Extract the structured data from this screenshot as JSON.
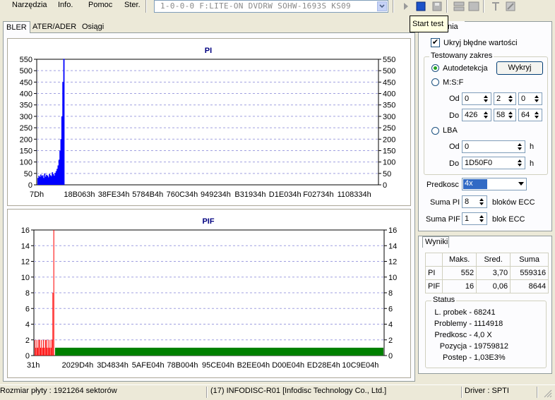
{
  "menu": {
    "narzedzia": "Narzędzia",
    "info": "Info.",
    "pomoc": "Pomoc",
    "ster": "Ster."
  },
  "drive": {
    "value": "1-0-0-0 F:LITE-ON DVDRW SOHW-1693S KS09"
  },
  "toolbar": {
    "tooltip": "Start test"
  },
  "tabs": {
    "bler": "BLER",
    "ater": "ATER/ADER",
    "osiagi": "Osiągi"
  },
  "settings": {
    "tab_fragment": "nia",
    "hide_errors": "Ukryj błędne wartości",
    "range_group": "Testowany zakres",
    "autodetect": "Autodetekcja",
    "detect_button": "Wykryj",
    "msf": "M:S:F",
    "od": "Od",
    "do": "Do",
    "msf_from": [
      "0",
      "2",
      "0"
    ],
    "msf_to": [
      "426",
      "58",
      "64"
    ],
    "lba": "LBA",
    "lba_from": "0",
    "lba_to": "1D50F0",
    "h": "h",
    "speed_label": "Predkosc",
    "speed_value": "4x",
    "sum_pi_label": "Suma PI",
    "sum_pi_value": "8",
    "sum_pi_unit": "bloków ECC",
    "sum_pif_label": "Suma PIF",
    "sum_pif_value": "1",
    "sum_pif_unit": "blok ECC"
  },
  "results": {
    "tab": "Wyniki",
    "headers": [
      "",
      "Maks.",
      "Sred.",
      "Suma"
    ],
    "rows": [
      [
        "PI",
        "552",
        "3,70",
        "559316"
      ],
      [
        "PIF",
        "16",
        "0,06",
        "8644"
      ]
    ],
    "status_group": "Status",
    "status": [
      {
        "label": "L. probek -",
        "value": "68241"
      },
      {
        "label": "Problemy -",
        "value": "1114918"
      },
      {
        "label": "Predkosc -",
        "value": "4,0  X"
      },
      {
        "label": "Pozycja -",
        "value": "19759812"
      },
      {
        "label": "Postep -",
        "value": "1,03E3%"
      }
    ]
  },
  "statusbar": {
    "size": "Rozmiar płyty : 1921264 sektorów",
    "disc": "(17) INFODISC-R01 [Infodisc Technology Co., Ltd.]",
    "driver": "Driver : SPTI"
  },
  "chart_data": [
    {
      "type": "bar",
      "title": "PI",
      "ylim": [
        0,
        550
      ],
      "yticks": [
        0,
        50,
        100,
        150,
        200,
        250,
        300,
        350,
        400,
        450,
        500,
        550
      ],
      "xticks": [
        "7Dh",
        "18B063h",
        "38FE34h",
        "5784B4h",
        "760C34h",
        "949234h",
        "B31934h",
        "D1E034h",
        "F02734h",
        "1108334h"
      ],
      "series": [
        {
          "color": "#0000ff",
          "values": [
            30,
            40,
            35,
            45,
            38,
            42,
            30,
            50,
            36,
            44,
            40,
            33,
            48,
            42,
            38,
            55,
            47,
            40,
            52,
            60,
            70,
            85,
            110,
            150,
            200,
            300,
            450,
            552
          ]
        }
      ],
      "grid": true
    },
    {
      "type": "bar",
      "title": "PIF",
      "ylim": [
        0,
        16
      ],
      "yticks": [
        0,
        2,
        4,
        6,
        8,
        10,
        12,
        14,
        16
      ],
      "xticks": [
        "31h",
        "2029D4h",
        "3D4834h",
        "5AFE04h",
        "78B004h",
        "95CE04h",
        "B2EE04h",
        "D00E04h",
        "ED28E4h",
        "10C9E04h"
      ],
      "series": [
        {
          "color": "#ff0000",
          "values": [
            2,
            1,
            2,
            1,
            2,
            2,
            1,
            2,
            1,
            2,
            1,
            2,
            2,
            1,
            2,
            1,
            2,
            1,
            2,
            8,
            16
          ]
        },
        {
          "color": "#008000",
          "values": [
            1
          ]
        }
      ],
      "grid": true
    }
  ]
}
